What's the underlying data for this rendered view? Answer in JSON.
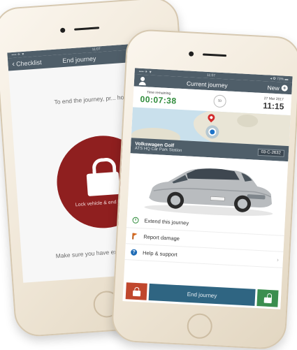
{
  "back_phone": {
    "status": {
      "carrier": "•••• ✈ ▼",
      "time": "11:07"
    },
    "nav": {
      "back_label": "Checklist",
      "title": "End journey"
    },
    "instruction_text": "To end the journey, pr... hold the button be...",
    "lock_label": "Lock vehicle & end journey",
    "reminder_text": "Make sure you have exit... and have all your belo..."
  },
  "front_phone": {
    "status": {
      "carrier": "•••• ✈ ▼",
      "time": "11:07",
      "battery": "◂ ✪ 73% ▬"
    },
    "nav": {
      "title": "Current journey",
      "new_label": "New"
    },
    "journey": {
      "time_remaining_label": "Time remaining",
      "time_remaining_value": "00:07:38",
      "to_label": "to",
      "end_date_label": "27 Mar 2017",
      "end_time_value": "11:15"
    },
    "car": {
      "name": "Volkswagen Golf",
      "location": "ATS HQ Car Park Station",
      "plate": "03-C-2632"
    },
    "menu": [
      {
        "label": "Extend this journey",
        "icon": "clock-icon"
      },
      {
        "label": "Report damage",
        "icon": "flag-icon"
      },
      {
        "label": "Help & support",
        "icon": "help-icon"
      }
    ],
    "actions": {
      "end_journey_label": "End journey"
    }
  },
  "colors": {
    "nav_bg": "#4f5e69",
    "lock_red": "#8f1f1f",
    "green": "#2e8b3a",
    "end_button": "#2f6582",
    "action_red": "#c0472d",
    "action_green": "#3b8e4f"
  }
}
